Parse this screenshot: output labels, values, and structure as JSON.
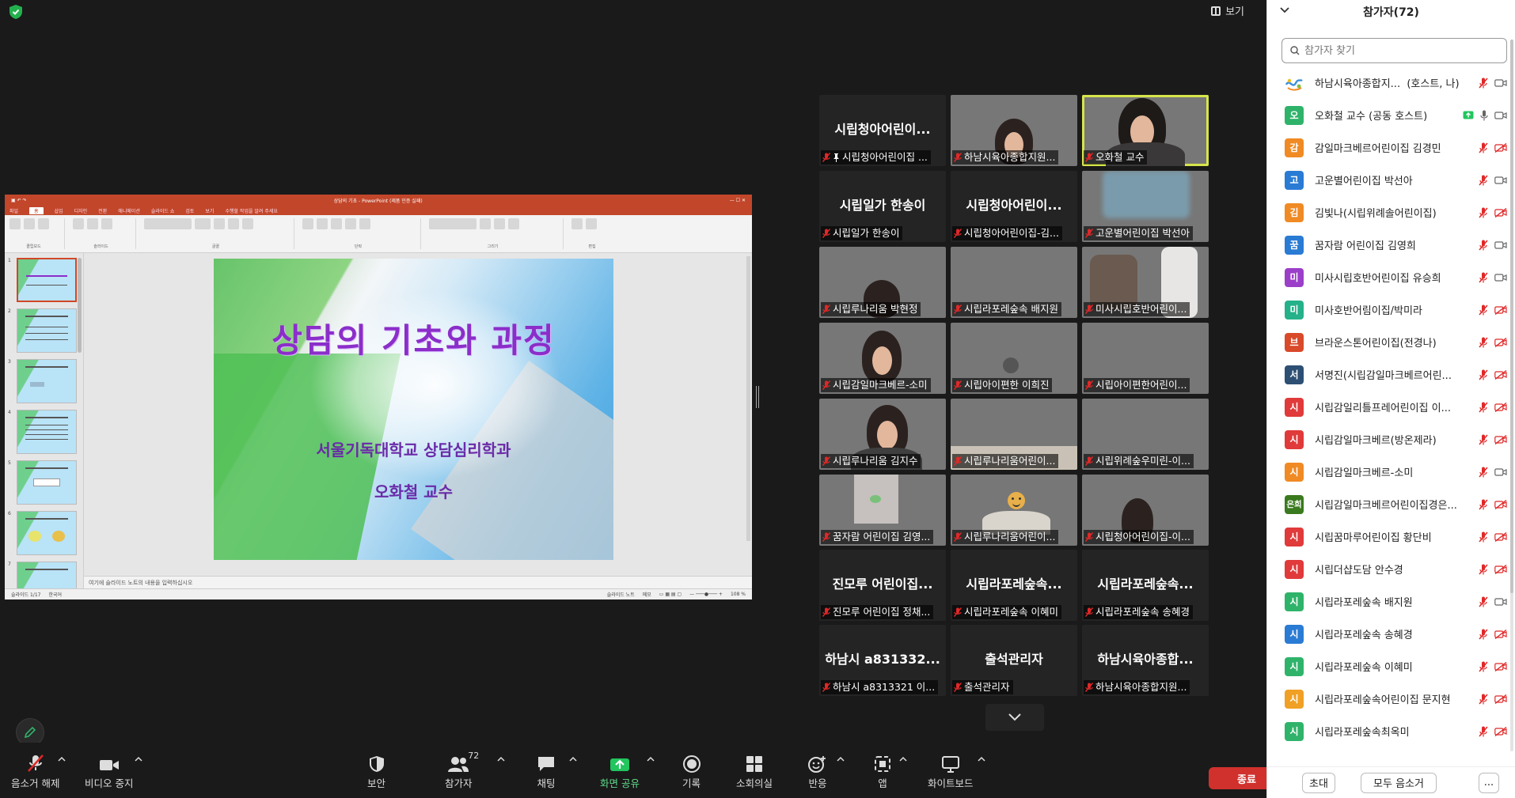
{
  "header": {
    "view_label": "보기"
  },
  "colors": {
    "mic_muted": "#e02828",
    "end_button": "#d0312d",
    "share_button": "#22c55e",
    "active_speaker": "#d6e54a",
    "ppt_brand": "#c2462a"
  },
  "ppt": {
    "window_title": "상담의 기초 - PowerPoint (제품 인증 실패)",
    "menu": [
      "파일",
      "홈",
      "삽입",
      "디자인",
      "전환",
      "애니메이션",
      "슬라이드 쇼",
      "검토",
      "보기",
      "수행할 작업을 알려 주세요"
    ],
    "ribbon_groups": [
      "클립보드",
      "슬라이드",
      "글꼴",
      "단락",
      "그리기",
      "편집"
    ],
    "slide": {
      "title": "상담의 기초와 과정",
      "subtitle": "서울기독대학교 상담심리학과",
      "presenter": "오화철 교수"
    },
    "thumbnails": [
      "1",
      "2",
      "3",
      "4",
      "5",
      "6",
      "7"
    ],
    "notes_placeholder": "여기에 슬라이드 노트의 내용을 입력하십시오",
    "status_left": "슬라이드 1/17",
    "status_lang": "한국어",
    "status_notes": "슬라이드 노트",
    "status_memo": "메모",
    "zoom": "108 %"
  },
  "tiles": [
    {
      "big": "시립청아어린이...",
      "label": "시립청아어린이집 ...",
      "pinned": true
    },
    {
      "big": "",
      "label": "하남시육아종합지원...",
      "video": "v-green"
    },
    {
      "big": "",
      "label": "오화철 교수",
      "video": "v-room",
      "active": true
    },
    {
      "big": "시립일가 한송이",
      "label": "시립일가 한송이"
    },
    {
      "big": "시립청아어린이...",
      "label": "시립청아어린이집-김..."
    },
    {
      "big": "",
      "label": "고운별어린이집 박선아",
      "video": "v-mint"
    },
    {
      "big": "",
      "label": "시립루나리움 박현정",
      "video": "v-dark"
    },
    {
      "big": "",
      "label": "시립라포레숲속 배지원",
      "video": "v-ceiling"
    },
    {
      "big": "",
      "label": "미사시립호반어린이...",
      "video": "v-bottle"
    },
    {
      "big": "",
      "label": "시립감일마크베르-소미",
      "video": "v-wall"
    },
    {
      "big": "",
      "label": "시립아이편한 이희진",
      "video": "v-wall"
    },
    {
      "big": "",
      "label": "시립아이편한어린이...",
      "video": "v-blur"
    },
    {
      "big": "",
      "label": "시립루나리움 김지수",
      "video": "v-dark"
    },
    {
      "big": "",
      "label": "시립루나리움어린이...",
      "video": "v-wall"
    },
    {
      "big": "",
      "label": "시립위례숲우미린-이...",
      "video": "v-blur"
    },
    {
      "big": "",
      "label": "꿈자람 어린이집 김영...",
      "video": "v-blur"
    },
    {
      "big": "",
      "label": "시립루나리움어린이...",
      "video": "v-wall"
    },
    {
      "big": "",
      "label": "시립청아어린이집-이...",
      "video": "v-wall"
    },
    {
      "big": "진모루 어린이집...",
      "label": "진모루 어린이집 정채..."
    },
    {
      "big": "시립라포레숲속...",
      "label": "시립라포레숲속 이혜미"
    },
    {
      "big": "시립라포레숲속...",
      "label": "시립라포레숲속 송혜경"
    },
    {
      "big": "하남시 a831332...",
      "label": "하남시 a8313321 이..."
    },
    {
      "big": "출석관리자",
      "label": "출석관리자"
    },
    {
      "big": "하남시육아종합...",
      "label": "하남시육아종합지원..."
    }
  ],
  "toolbar": {
    "unmute": "음소거 해제",
    "stop_video": "비디오 중지",
    "security": "보안",
    "participants": "참가자",
    "participant_count": "72",
    "chat": "채팅",
    "share": "화면 공유",
    "record": "기록",
    "breakout": "소회의실",
    "reactions": "반응",
    "apps": "앱",
    "whiteboard": "화이트보드",
    "end": "종료"
  },
  "panel": {
    "title": "참가자(72)",
    "search_placeholder": "참가자 찾기",
    "invite": "초대",
    "mute_all": "모두 음소거",
    "more": "...",
    "participants": [
      {
        "initial": "",
        "name": "하남시육아종합지...",
        "role": "(호스트, 나)",
        "color": "#ffffff",
        "logo": true,
        "mic": "off",
        "cam": "on"
      },
      {
        "initial": "오",
        "name": "오화철 교수 (공동 호스트)",
        "color": "#2fb36a",
        "mic": "on",
        "cam": "on",
        "sharing": true
      },
      {
        "initial": "감",
        "name": "감일마크베르어린이집 김경민",
        "color": "#f08a24",
        "mic": "off",
        "cam": "off"
      },
      {
        "initial": "고",
        "name": "고운별어린이집 박선아",
        "color": "#2a7bd4",
        "mic": "off",
        "cam": "on"
      },
      {
        "initial": "김",
        "name": "김빛나(시립위례솔어린이집)",
        "color": "#f08a24",
        "mic": "off",
        "cam": "off"
      },
      {
        "initial": "꿈",
        "name": "꿈자람 어린이집 김영희",
        "color": "#2a7bd4",
        "mic": "off",
        "cam": "on"
      },
      {
        "initial": "미",
        "name": "미사시립호반어린이집 유승희",
        "color": "#9b3fc9",
        "mic": "off",
        "cam": "on"
      },
      {
        "initial": "미",
        "name": "미사호반어림이집/박미라",
        "color": "#25b18a",
        "mic": "off",
        "cam": "off"
      },
      {
        "initial": "브",
        "name": "브라운스톤어린이집(전경나)",
        "color": "#d84a2a",
        "mic": "off",
        "cam": "off"
      },
      {
        "initial": "서",
        "name": "서명진(시립감일마크베르어린...",
        "color": "#2d4f73",
        "mic": "off",
        "cam": "off"
      },
      {
        "initial": "시",
        "name": "시립감일리틀프레어린이집  이...",
        "color": "#e03a3a",
        "mic": "off",
        "cam": "off"
      },
      {
        "initial": "시",
        "name": "시립감일마크베르(방온제라)",
        "color": "#e03a3a",
        "mic": "off",
        "cam": "off"
      },
      {
        "initial": "시",
        "name": "시립감일마크베르-소미",
        "color": "#f08a24",
        "mic": "off",
        "cam": "on"
      },
      {
        "initial": "은희",
        "name": "시립감일마크베르어린이집경은...",
        "color": "#3a7a1e",
        "mic": "off",
        "cam": "off"
      },
      {
        "initial": "시",
        "name": "시립꿈마루어린이집 황단비",
        "color": "#e03a3a",
        "mic": "off",
        "cam": "off"
      },
      {
        "initial": "시",
        "name": "시립더샵도담 안수경",
        "color": "#e03a3a",
        "mic": "off",
        "cam": "off"
      },
      {
        "initial": "시",
        "name": "시립라포레숲속 배지원",
        "color": "#2fb36a",
        "mic": "off",
        "cam": "on"
      },
      {
        "initial": "시",
        "name": "시립라포레숲속 송혜경",
        "color": "#2a7bd4",
        "mic": "off",
        "cam": "off"
      },
      {
        "initial": "시",
        "name": "시립라포레숲속 이혜미",
        "color": "#2fb36a",
        "mic": "off",
        "cam": "off"
      },
      {
        "initial": "시",
        "name": "시립라포레숲속어린이집 문지현",
        "color": "#f0a024",
        "mic": "off",
        "cam": "off"
      },
      {
        "initial": "시",
        "name": "시립라포레숲속최옥미",
        "color": "#2fb36a",
        "mic": "off",
        "cam": "off"
      }
    ]
  }
}
